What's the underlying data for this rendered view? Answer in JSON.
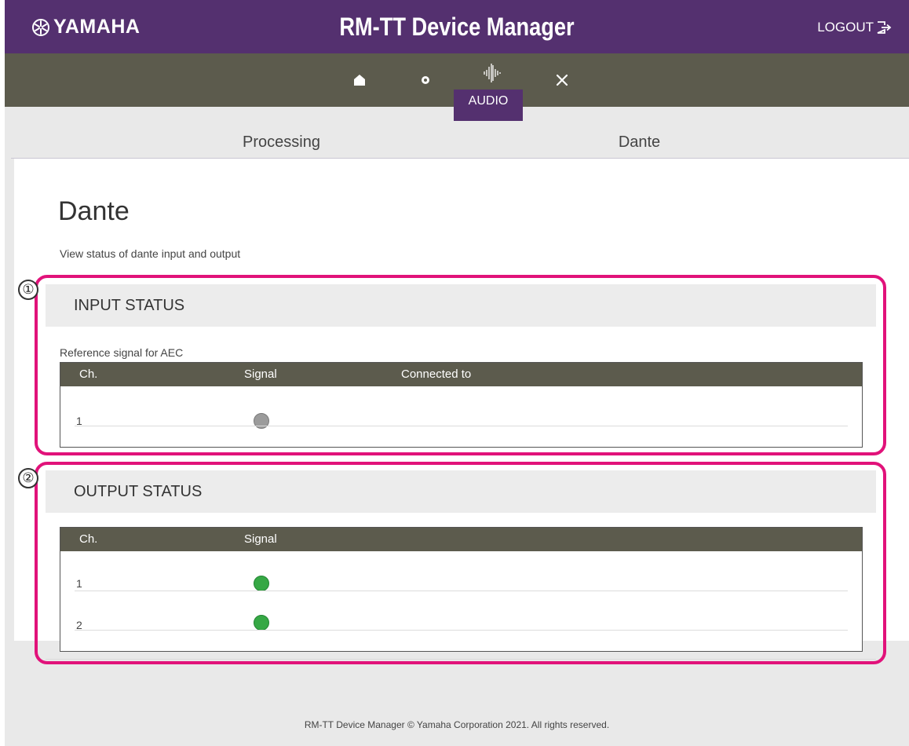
{
  "header": {
    "brand": "YAMAHA",
    "title": "RM-TT Device Manager",
    "logout_label": "LOGOUT",
    "accent_color": "#54306f"
  },
  "nav": {
    "items": [
      {
        "icon": "home-icon"
      },
      {
        "icon": "gear-icon"
      },
      {
        "icon": "audio-waveform-icon",
        "label": "AUDIO",
        "active": true
      },
      {
        "icon": "tools-icon"
      }
    ]
  },
  "tabs": [
    {
      "label": "Processing",
      "active": false
    },
    {
      "label": "Dante",
      "active": true
    }
  ],
  "page": {
    "title": "Dante",
    "description": "View status of dante input and output"
  },
  "input_status": {
    "callout_number": "①",
    "heading": "INPUT STATUS",
    "sublabel": "Reference signal for AEC",
    "columns": [
      "Ch.",
      "Signal",
      "Connected to"
    ],
    "rows": [
      {
        "ch": "1",
        "signal": "inactive",
        "connected_to": ""
      }
    ]
  },
  "output_status": {
    "callout_number": "②",
    "heading": "OUTPUT STATUS",
    "columns": [
      "Ch.",
      "Signal"
    ],
    "rows": [
      {
        "ch": "1",
        "signal": "active"
      },
      {
        "ch": "2",
        "signal": "active"
      }
    ]
  },
  "colors": {
    "signal_active": "#36a845",
    "signal_inactive": "#9b9b9b",
    "callout": "#e1127a"
  },
  "footer": {
    "text": "RM-TT Device Manager © Yamaha Corporation 2021. All rights reserved."
  }
}
